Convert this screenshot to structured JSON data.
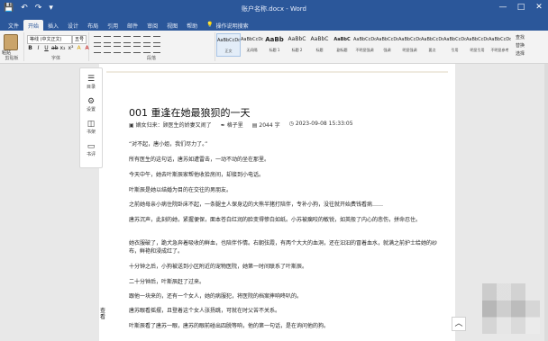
{
  "titlebar": {
    "title": "账户名称.docx - Word",
    "quick_access": [
      "💾",
      "↶",
      "↷",
      "▾"
    ],
    "window_controls": [
      "—",
      "□",
      "✕"
    ]
  },
  "tabs": {
    "items": [
      "文件",
      "开始",
      "插入",
      "设计",
      "布局",
      "引用",
      "邮件",
      "审阅",
      "视图",
      "帮助"
    ],
    "active_index": 1,
    "tell_me": "操作说明搜索"
  },
  "ribbon": {
    "clipboard": {
      "paste_label": "粘贴",
      "group_label": "剪贴板"
    },
    "font": {
      "name": "等线 (中文正文)",
      "size": "五号",
      "group_label": "字体",
      "buttons": [
        "B",
        "I",
        "U",
        "ab",
        "x₂",
        "x²",
        "A",
        "A"
      ]
    },
    "paragraph": {
      "group_label": "段落"
    },
    "styles": {
      "group_label": "样式",
      "items": [
        {
          "preview": "AaBbCcDd",
          "name": "正文"
        },
        {
          "preview": "AaBbCcDd",
          "name": "无间隔"
        },
        {
          "preview": "AaBb",
          "name": "标题 1"
        },
        {
          "preview": "AaBbC",
          "name": "标题 2"
        },
        {
          "preview": "AaBbC",
          "name": "标题"
        },
        {
          "preview": "AaBbC",
          "name": "副标题"
        },
        {
          "preview": "AaBbCcDd",
          "name": "不明显强调"
        },
        {
          "preview": "AaBbCcDd",
          "name": "强调"
        },
        {
          "preview": "AaBbCcDd",
          "name": "明显强调"
        },
        {
          "preview": "AaBbCcDd",
          "name": "要点"
        },
        {
          "preview": "AaBbCcDd",
          "name": "引用"
        },
        {
          "preview": "AaBbCcDd",
          "name": "明显引用"
        },
        {
          "preview": "AaBbCcDd",
          "name": "不明显参考"
        }
      ]
    },
    "editing": {
      "items": [
        "查找",
        "替换",
        "选择"
      ],
      "group_label": "编辑"
    }
  },
  "toc": {
    "items": [
      {
        "icon": "☰",
        "label": "目录"
      },
      {
        "icon": "⚙",
        "label": "设置"
      },
      {
        "icon": "◫",
        "label": "书架"
      },
      {
        "icon": "▭",
        "label": "书评"
      }
    ]
  },
  "article": {
    "title": "001 重逢在她最狼狈的一天",
    "meta": {
      "book": "嫡女归来：顾医生的娇妻又闹了",
      "author": "格子里",
      "words": "2044 字",
      "time": "2023-09-08 15:33:05"
    },
    "paragraphs": [
      "“对不起，唐小姐，我们尽力了。”",
      "所有医生的这句话，唐苏如遭雷击，一动不动的坐在那里。",
      "今天中午，她去叶斯辰家帮他收拾房间，却接到小电话。",
      "叶斯辰是她以结婚为目的在交往的男朋友。",
      "之前她母亲小病住院卧床不起，一条腿主人保身边的大熊半猪打陪伴，专补小狗，没往就开始费钱看病……",
      "唐苏沉声，此刻的她，紧握便保，面本苍白红润的脸变得惨白如纸。小苏被瘸咬的敏锐，如英般了内心的悲伤，拼命忍住。",
      "她衣服破了，跪犬急奔着吸收的鲜血，也陪伴作情。右朝弦霞，有两个大大的血洞，还在汩汩的冒着血水，就满之前护士给她的纱布，鲜艳和浸成红了。",
      "十分钟之后，小狗被送到小区附近的宠物医院，她第一时间联系了叶斯辰。",
      "二十分钟后，叶斯辰赶了过来。",
      "跟他一块来的，还有一个女人，她的病服犯，将医院的档案摔响咚叭的。",
      "唐苏眼看摇摆，且登着这个女人张扬跳，可就在时父苦不关系。",
      "叶斯辰看了唐苏一眼，唐苏的眼前碰出四脱等响，他的第一句话，是在询问他的狗。"
    ]
  },
  "side_note": "查看",
  "to_top": "︿"
}
